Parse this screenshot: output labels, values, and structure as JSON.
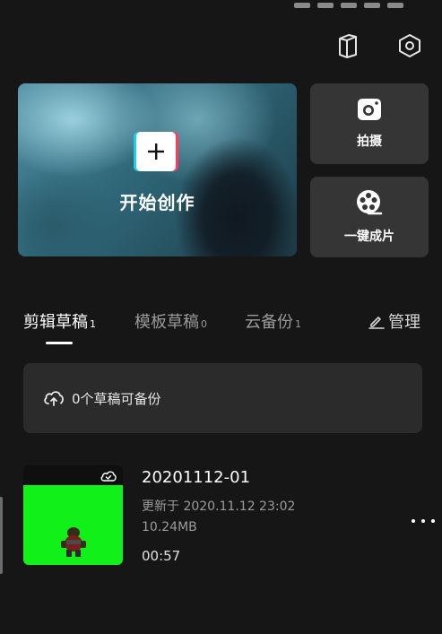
{
  "header": {
    "icons": [
      "book-icon",
      "settings-hexagon-icon"
    ]
  },
  "hero": {
    "label": "开始创作"
  },
  "side_cards": [
    {
      "label": "拍摄",
      "icon": "camera-icon"
    },
    {
      "label": "一键成片",
      "icon": "film-reel-icon"
    }
  ],
  "tabs": [
    {
      "label": "剪辑草稿",
      "count": "1",
      "active": true
    },
    {
      "label": "模板草稿",
      "count": "0",
      "active": false
    },
    {
      "label": "云备份",
      "count": "1",
      "active": false
    }
  ],
  "manage": {
    "label": "管理"
  },
  "backup_banner": {
    "text": "0个草稿可备份"
  },
  "drafts": [
    {
      "title": "20201112-01",
      "updated": "更新于 2020.11.12 23:02",
      "size": "10.24MB",
      "duration": "00:57"
    }
  ],
  "colors": {
    "background": "#161616",
    "card": "#353535",
    "banner": "#2b2b2b",
    "thumb_green": "#11f018",
    "accent_cyan": "#1fd1e0",
    "accent_red": "#ff3b5c"
  }
}
